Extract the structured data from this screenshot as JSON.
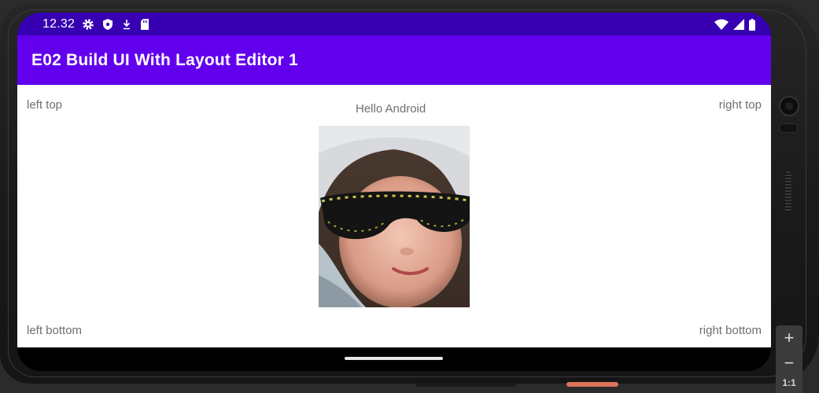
{
  "status_bar": {
    "time": "12.32",
    "left_icons": [
      "settings-icon",
      "shield-icon",
      "download-icon",
      "sd-card-icon"
    ],
    "right_icons": [
      "wifi-icon",
      "signal-icon",
      "battery-icon"
    ],
    "background": "#3700b3"
  },
  "app_bar": {
    "title": "E02 Build UI With Layout Editor 1",
    "background": "#6200ee"
  },
  "content": {
    "left_top": "left top",
    "hello": "Hello Android",
    "right_top": "right top",
    "left_bottom": "left bottom",
    "right_bottom": "right bottom",
    "image": "child-with-sunglasses-photo"
  },
  "emulator_toolbar": {
    "zoom_in": "+",
    "zoom_out": "−",
    "actual_size": "1:1"
  }
}
